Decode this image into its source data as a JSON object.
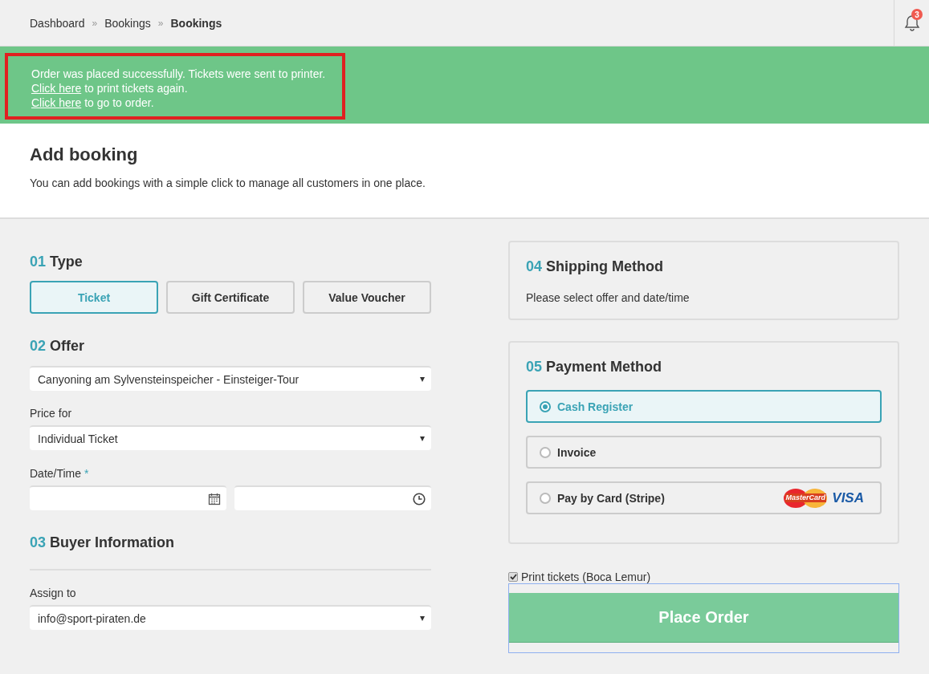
{
  "breadcrumb": [
    {
      "label": "Dashboard",
      "current": false
    },
    {
      "separator": "»",
      "label": "Bookings",
      "current": false
    },
    {
      "separator": "»",
      "label": "Bookings",
      "current": true
    }
  ],
  "notifications": {
    "count": "3"
  },
  "alert": {
    "highlighted": true,
    "lines": [
      {
        "text": "Order was placed successfully. Tickets were sent to printer."
      },
      {
        "link": "Click here",
        "text": " to print tickets again."
      },
      {
        "link": "Click here",
        "text": " to go to order."
      }
    ]
  },
  "page": {
    "title": "Add booking",
    "subtitle": "You can add bookings with a simple click to manage all customers in one place."
  },
  "type_section": {
    "number": "01",
    "title": "Type",
    "options": [
      {
        "label": "Ticket",
        "selected": true
      },
      {
        "label": "Gift Certificate",
        "selected": false
      },
      {
        "label": "Value Voucher",
        "selected": false
      }
    ]
  },
  "offer_section": {
    "number": "02",
    "title": "Offer",
    "offer_value": "Canyoning am Sylvensteinspeicher - Einsteiger-Tour",
    "price_label": "Price for",
    "price_value": "Individual Ticket",
    "date_label": "Date/Time",
    "required_mark": "*"
  },
  "buyer_section": {
    "number": "03",
    "title": "Buyer Information",
    "assign_label": "Assign to",
    "assign_value": "info@sport-piraten.de"
  },
  "shipping_section": {
    "number": "04",
    "title": "Shipping Method",
    "note": "Please select offer and date/time"
  },
  "payment_section": {
    "number": "05",
    "title": "Payment Method",
    "options": [
      {
        "label": "Cash Register",
        "selected": true
      },
      {
        "label": "Invoice",
        "selected": false
      },
      {
        "label": "Pay by Card (Stripe)",
        "selected": false,
        "logos": [
          "MasterCard",
          "VISA"
        ]
      }
    ]
  },
  "print_tickets": {
    "label": "Print tickets (Boca Lemur)",
    "checked": true
  },
  "place_order": {
    "label": "Place Order",
    "focused": true
  }
}
